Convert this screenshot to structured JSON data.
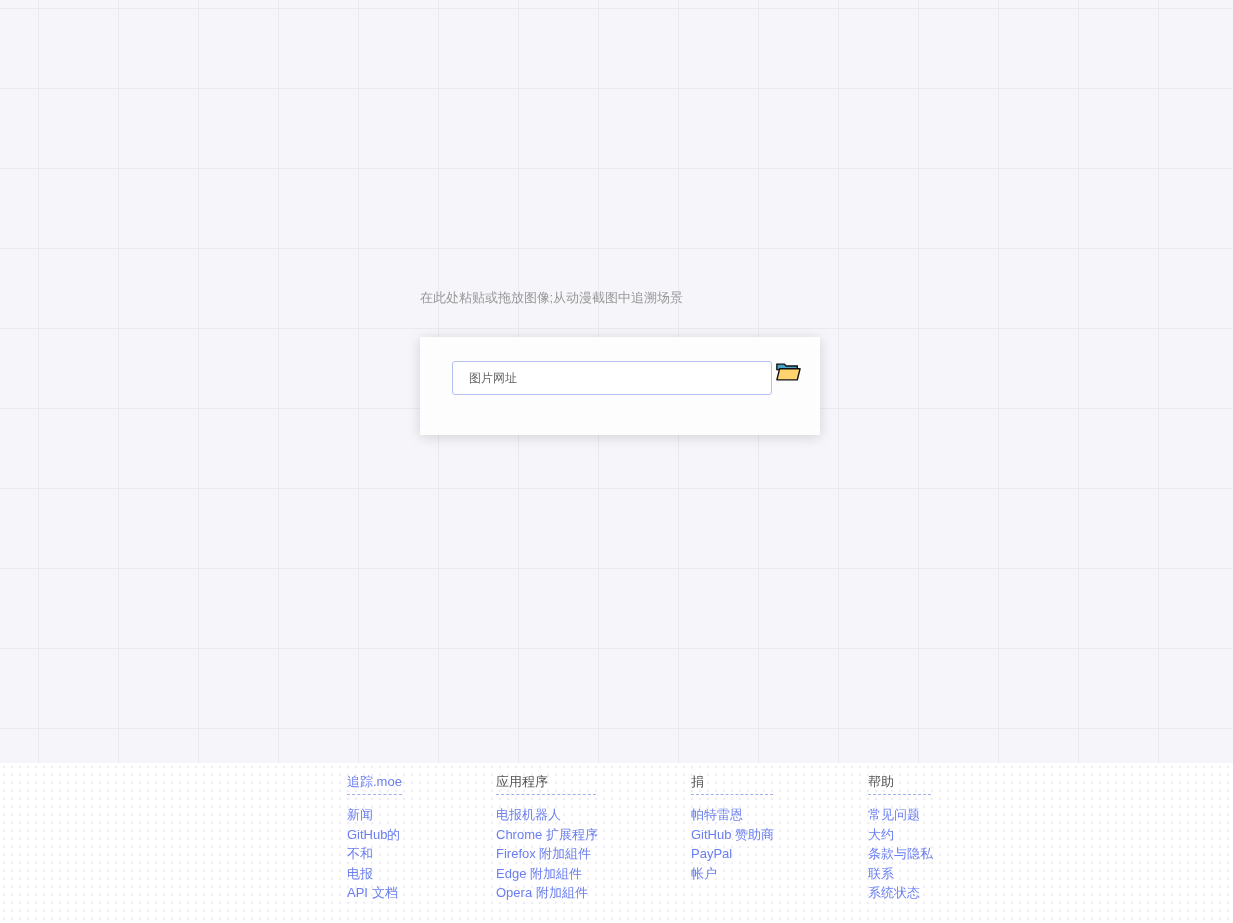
{
  "hint": "在此处粘贴或拖放图像;从动漫截图中追溯场景",
  "search": {
    "placeholder": "图片网址"
  },
  "footer": [
    {
      "heading": "追踪.moe",
      "heading_link": true,
      "links": [
        "新闻",
        "GitHub的",
        "不和",
        "电报",
        "API 文档"
      ]
    },
    {
      "heading": "应用程序",
      "heading_link": false,
      "links": [
        "电报机器人",
        "Chrome 扩展程序",
        "Firefox 附加組件",
        "Edge 附加組件",
        "Opera 附加組件"
      ]
    },
    {
      "heading": "捐",
      "heading_link": false,
      "links": [
        "帕特雷恩",
        "GitHub 赞助商",
        "PayPal",
        "帐户"
      ]
    },
    {
      "heading": "帮助",
      "heading_link": false,
      "links": [
        "常见问题",
        "大约",
        "条款与隐私",
        "联系",
        "系统状态"
      ]
    }
  ]
}
